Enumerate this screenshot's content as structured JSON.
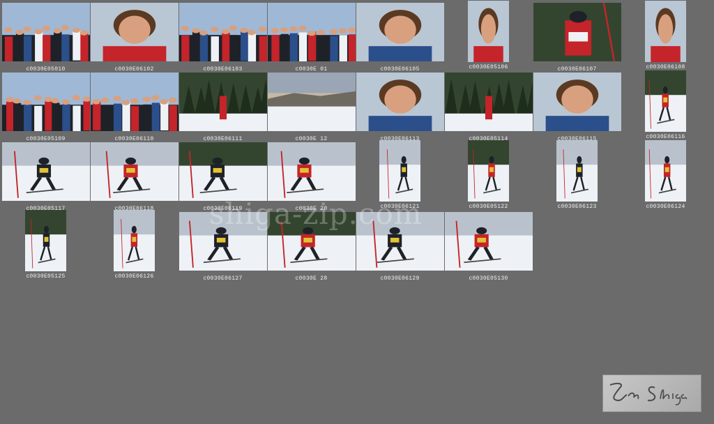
{
  "watermark_text": "shiga-zip.com",
  "signature_text": "Zen Shiga",
  "colors": {
    "background": "#6b6b6b",
    "caption": "#f0f0f0",
    "snow": "#eef2f6",
    "sky": "#9fb8d6",
    "forest": "#33452f",
    "dark": "#1e2228",
    "red": "#c4242a",
    "skin": "#d8a07e"
  },
  "thumbnails": [
    {
      "caption": "c0030E05010",
      "kind": "crowd"
    },
    {
      "caption": "c0030E06102",
      "kind": "portrait"
    },
    {
      "caption": "c0030E06103",
      "kind": "crowd"
    },
    {
      "caption": "c0030E 01",
      "kind": "crowd"
    },
    {
      "caption": "c0030E06105",
      "kind": "portrait"
    },
    {
      "caption": "c0030E05106",
      "kind": "portrait"
    },
    {
      "caption": "c0030E06107",
      "kind": "racer"
    },
    {
      "caption": "c0030E06108",
      "kind": "portrait"
    },
    {
      "caption": "c0030E05109",
      "kind": "crowd"
    },
    {
      "caption": "c0030E06110",
      "kind": "crowd"
    },
    {
      "caption": "c0030E06111",
      "kind": "forest"
    },
    {
      "caption": "c0030E 12",
      "kind": "landscape"
    },
    {
      "caption": "c0030E06113",
      "kind": "portrait"
    },
    {
      "caption": "c0030E05114",
      "kind": "forest"
    },
    {
      "caption": "c0030E06115",
      "kind": "portrait"
    },
    {
      "caption": "c0030E06116",
      "kind": "skier"
    },
    {
      "caption": "c0030E05117",
      "kind": "skier"
    },
    {
      "caption": "c0030E06118",
      "kind": "skier"
    },
    {
      "caption": "c0030E06119",
      "kind": "skier"
    },
    {
      "caption": "c0030E 20",
      "kind": "skier"
    },
    {
      "caption": "c0030E06121",
      "kind": "skier"
    },
    {
      "caption": "c0030E05122",
      "kind": "skier"
    },
    {
      "caption": "c0030E06123",
      "kind": "skier"
    },
    {
      "caption": "c0030E06124",
      "kind": "skier"
    },
    {
      "caption": "c0030E05125",
      "kind": "skier"
    },
    {
      "caption": "c0030E06126",
      "kind": "skier"
    },
    {
      "caption": "c0030E06127",
      "kind": "skier"
    },
    {
      "caption": "c0030E 28",
      "kind": "skier"
    },
    {
      "caption": "c0030E06129",
      "kind": "skier"
    },
    {
      "caption": "c0030E05130",
      "kind": "skier"
    }
  ]
}
